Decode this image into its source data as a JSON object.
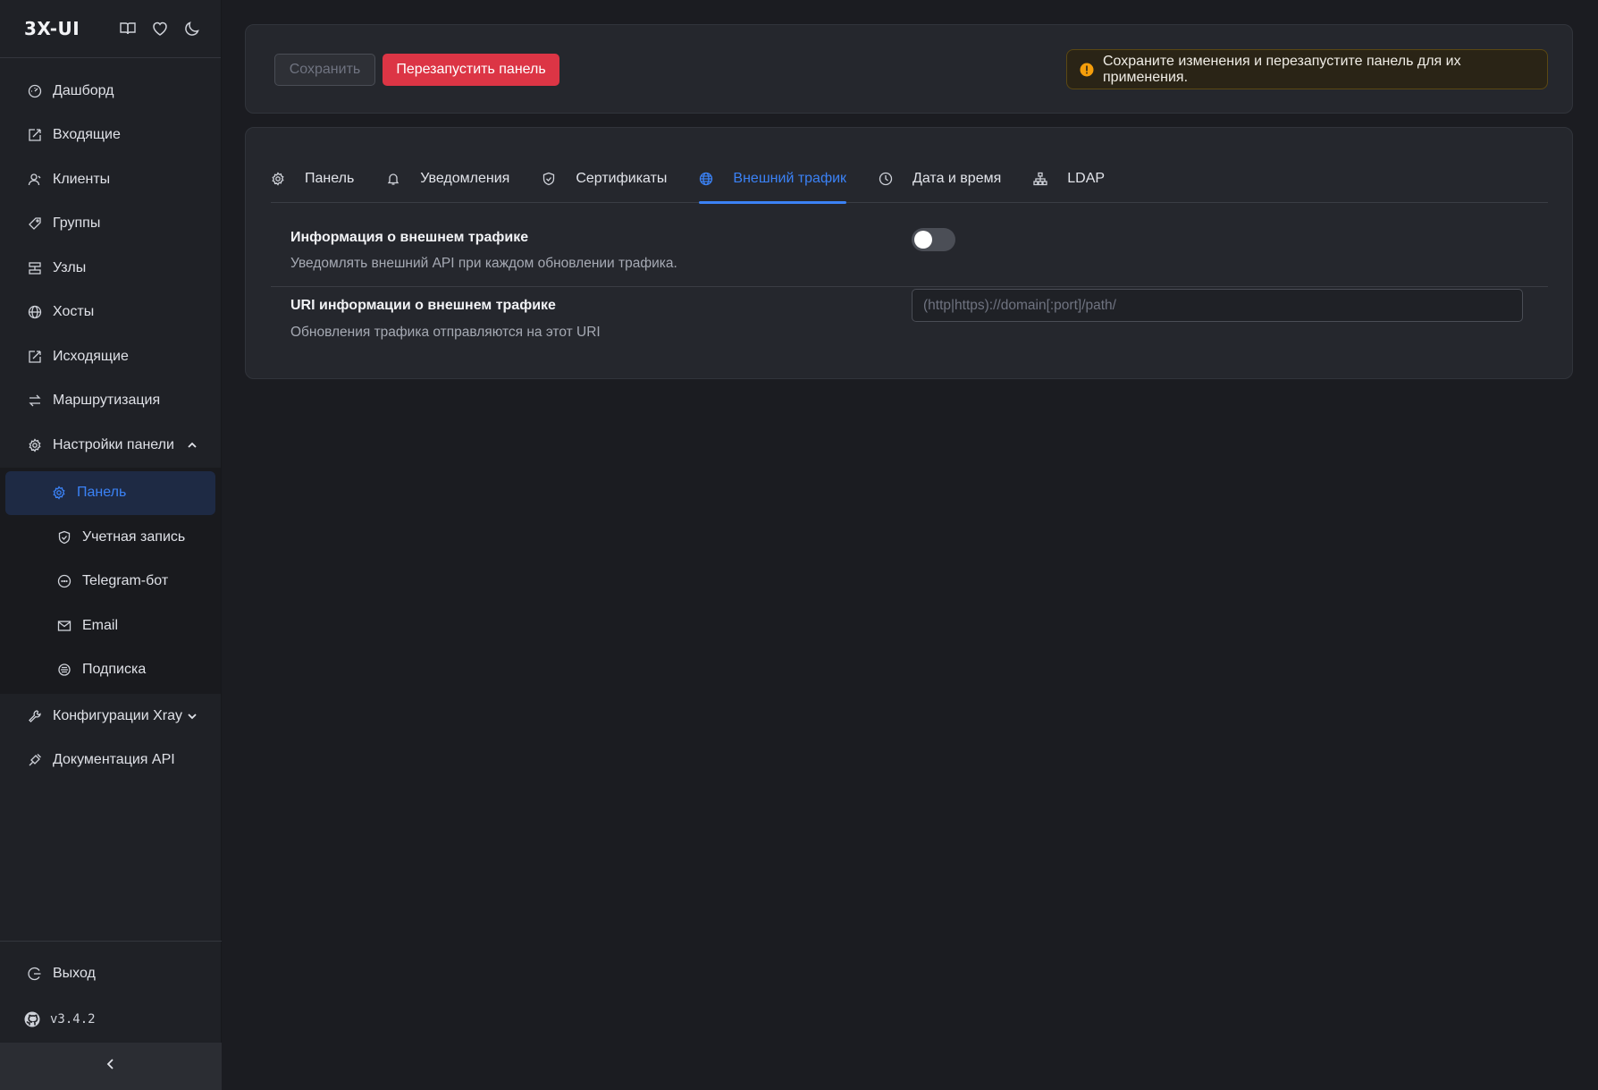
{
  "brand": {
    "title": "3X-UI"
  },
  "sidebar": {
    "items": [
      {
        "label": "Дашборд",
        "icon": "dashboard-icon"
      },
      {
        "label": "Входящие",
        "icon": "inbound-icon"
      },
      {
        "label": "Клиенты",
        "icon": "clients-icon"
      },
      {
        "label": "Группы",
        "icon": "tag-icon"
      },
      {
        "label": "Узлы",
        "icon": "nodes-icon"
      },
      {
        "label": "Хосты",
        "icon": "globe-icon"
      },
      {
        "label": "Исходящие",
        "icon": "outbound-icon"
      },
      {
        "label": "Маршрутизация",
        "icon": "routing-icon"
      },
      {
        "label": "Настройки панели",
        "icon": "gear-icon"
      }
    ],
    "settings_sub": [
      {
        "label": "Панель",
        "icon": "gear-icon"
      },
      {
        "label": "Учетная запись",
        "icon": "shield-icon"
      },
      {
        "label": "Telegram-бот",
        "icon": "chat-icon"
      },
      {
        "label": "Email",
        "icon": "mail-icon"
      },
      {
        "label": "Подписка",
        "icon": "subscription-icon"
      }
    ],
    "after": [
      {
        "label": "Конфигурации Xray",
        "icon": "tool-icon"
      },
      {
        "label": "Документация API",
        "icon": "api-icon"
      }
    ],
    "logout": "Выход",
    "version": "v3.4.2"
  },
  "toolbar": {
    "save_label": "Сохранить",
    "restart_label": "Перезапустить панель",
    "alert_text": "Сохраните изменения и перезапустите панель для их применения."
  },
  "tabs": [
    {
      "label": "Панель",
      "icon": "gear-icon"
    },
    {
      "label": "Уведомления",
      "icon": "bell-icon"
    },
    {
      "label": "Сертификаты",
      "icon": "shield-icon"
    },
    {
      "label": "Внешний трафик",
      "icon": "globe-icon"
    },
    {
      "label": "Дата и время",
      "icon": "clock-icon"
    },
    {
      "label": "LDAP",
      "icon": "sitemap-icon"
    }
  ],
  "settings": {
    "external_traffic": {
      "title": "Информация о внешнем трафике",
      "desc": "Уведомлять внешний API при каждом обновлении трафика.",
      "enabled": false
    },
    "uri": {
      "title": "URI информации о внешнем трафике",
      "desc": "Обновления трафика отправляются на этот URI",
      "value": "",
      "placeholder": "(http|https)://domain[:port]/path/"
    }
  },
  "colors": {
    "accent": "#3b82f6",
    "danger": "#dc3545",
    "warning": "#f59e0b",
    "background": "#1b1c21"
  }
}
